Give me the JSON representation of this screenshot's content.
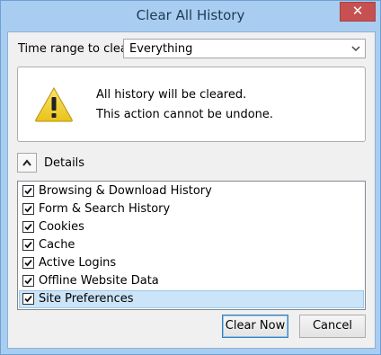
{
  "window": {
    "title": "Clear All History",
    "close_glyph": "✕"
  },
  "time_range": {
    "label": "Time range to clear:",
    "selected": "Everything"
  },
  "warning": {
    "icon": "warning-icon",
    "line1": "All history will be cleared.",
    "line2": "This action cannot be undone."
  },
  "details": {
    "label": "Details",
    "expanded": true,
    "items": [
      {
        "label": "Browsing & Download History",
        "checked": true,
        "selected": false
      },
      {
        "label": "Form & Search History",
        "checked": true,
        "selected": false
      },
      {
        "label": "Cookies",
        "checked": true,
        "selected": false
      },
      {
        "label": "Cache",
        "checked": true,
        "selected": false
      },
      {
        "label": "Active Logins",
        "checked": true,
        "selected": false
      },
      {
        "label": "Offline Website Data",
        "checked": true,
        "selected": false
      },
      {
        "label": "Site Preferences",
        "checked": true,
        "selected": true
      }
    ]
  },
  "buttons": {
    "clear_now": "Clear Now",
    "cancel": "Cancel"
  },
  "colors": {
    "frame": "#a9cdf0",
    "close": "#c75050",
    "selection": "#cce4f7",
    "warning_yellow": "#f7d83b"
  }
}
